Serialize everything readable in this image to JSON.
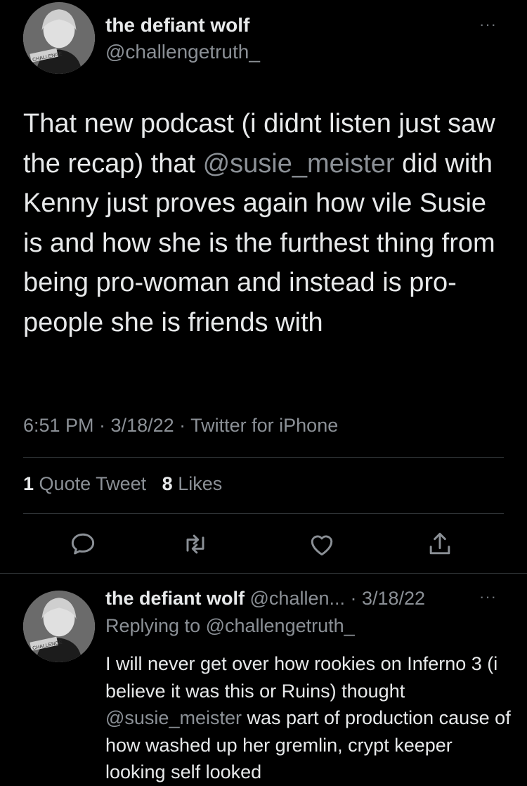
{
  "main_tweet": {
    "author_name": "the defiant wolf",
    "author_handle": "@challengetruth_",
    "text_before": "That new podcast (i didnt listen just saw the recap) that ",
    "mention": "@susie_meister",
    "text_after": " did with Kenny just proves again how vile Susie is and how she is the furthest thing from being pro-woman and instead is pro-people she is friends with",
    "meta": "6:51 PM · 3/18/22 · Twitter for iPhone",
    "quote_count": "1",
    "quote_label": "Quote Tweet",
    "like_count": "8",
    "like_label": "Likes",
    "more_icon": "···",
    "avatar_badge": "CHALLENGE"
  },
  "actions": [
    {
      "name": "reply-icon"
    },
    {
      "name": "retweet-icon"
    },
    {
      "name": "like-icon"
    },
    {
      "name": "share-icon"
    }
  ],
  "reply_tweet": {
    "author_name": "the defiant wolf",
    "author_meta": "@challen... · 3/18/22",
    "replying_prefix": "Replying to ",
    "replying_handle": "@challengetruth_",
    "text_before": "I will never get over how rookies on Inferno 3 (i believe it was this or Ruins) thought ",
    "mention": "@susie_meister",
    "text_after": " was part of production cause of how washed up her gremlin, crypt keeper looking self looked",
    "more_icon": "···",
    "avatar_badge": "CHALLENGE"
  },
  "colors": {
    "background": "#000000",
    "text": "#e7e9ea",
    "secondary": "#8b9096",
    "divider": "#2f3336"
  }
}
